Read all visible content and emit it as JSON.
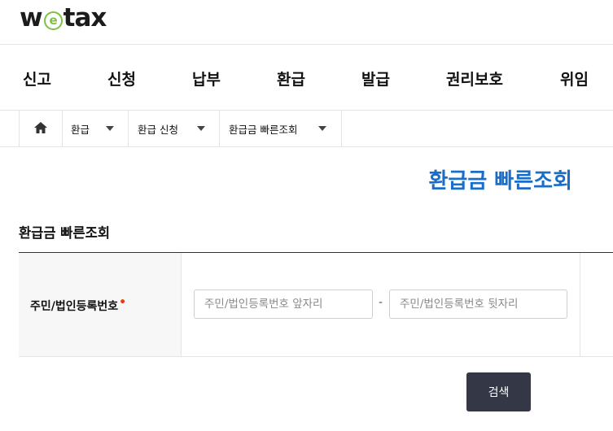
{
  "brand": {
    "logo_w": "w",
    "logo_e": "e",
    "logo_rest": "tax",
    "accent_color": "#7dc241"
  },
  "nav": {
    "items": [
      "신고",
      "신청",
      "납부",
      "환급",
      "발급",
      "권리보호",
      "위임"
    ]
  },
  "breadcrumb": {
    "home_icon": "home-icon",
    "items": [
      "환급",
      "환급 신청",
      "환급금 빠른조회"
    ]
  },
  "page": {
    "title": "환급금 빠른조회",
    "title_color": "#1a6dc9"
  },
  "section": {
    "title": "환급금 빠른조회"
  },
  "form": {
    "id_label": "주민/법인등록번호",
    "required_mark": "•",
    "front_placeholder": "주민/법인등록번호 앞자리",
    "separator": "-",
    "back_placeholder": "주민/법인등록번호 뒷자리"
  },
  "actions": {
    "search_label": "검색",
    "button_color": "#343846"
  }
}
